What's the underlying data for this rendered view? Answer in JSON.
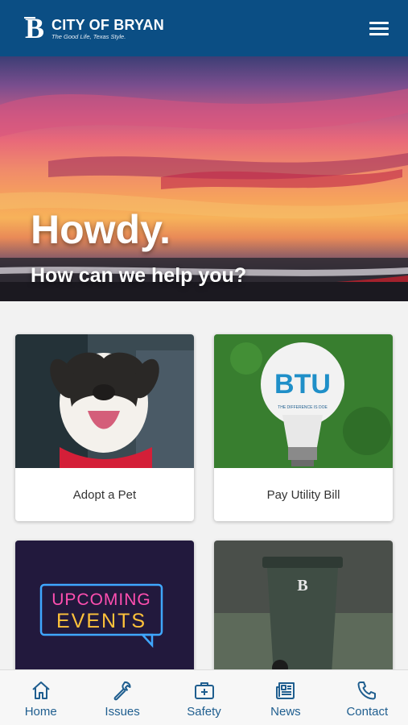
{
  "header": {
    "title": "CITY OF BRYAN",
    "tagline": "The Good Life, Texas Style.",
    "logo_letter": "B",
    "menu_icon": "hamburger-menu-icon",
    "background": "#0b4e84"
  },
  "hero": {
    "title": "Howdy.",
    "subtitle": "How can we help you?"
  },
  "cards": [
    {
      "label": "Adopt a Pet"
    },
    {
      "label": "Pay Utility Bill",
      "image_text": "BTU",
      "image_small_text": "THE DIFFERENCE IS DOE"
    },
    {
      "label": "",
      "image_text_1": "UPCOMING",
      "image_text_2": "EVENTS"
    },
    {
      "label": "",
      "image_text": "B"
    }
  ],
  "nav": [
    {
      "label": "Home",
      "icon": "home-icon"
    },
    {
      "label": "Issues",
      "icon": "wrench-icon"
    },
    {
      "label": "Safety",
      "icon": "first-aid-kit-icon"
    },
    {
      "label": "News",
      "icon": "newspaper-icon"
    },
    {
      "label": "Contact",
      "icon": "phone-icon"
    }
  ],
  "colors": {
    "brand": "#0b4e84",
    "nav_accent": "#1f5e8f"
  }
}
